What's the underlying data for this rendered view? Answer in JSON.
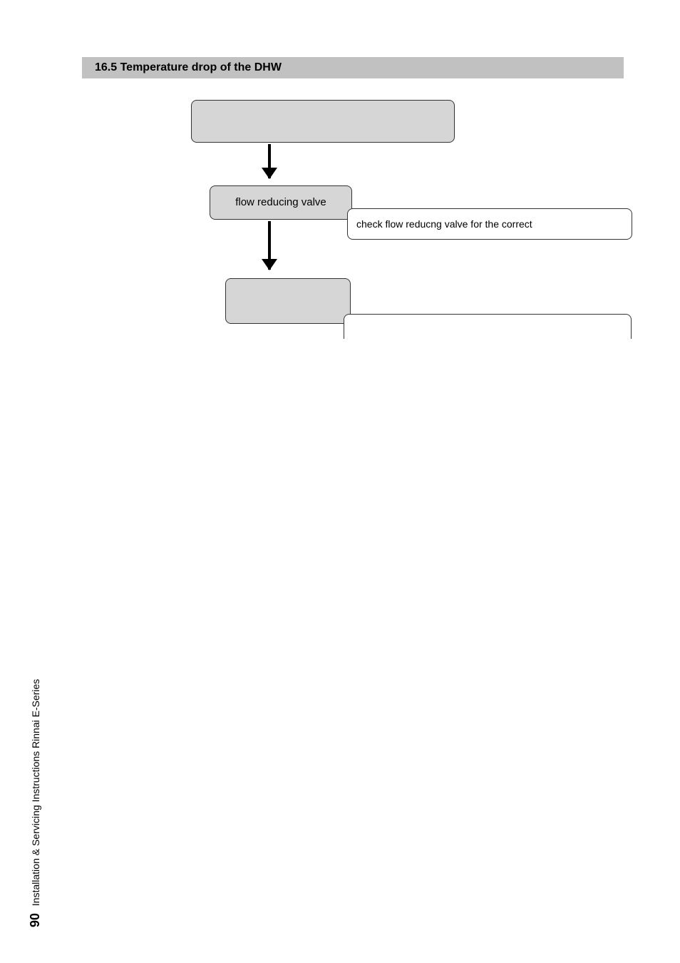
{
  "section": {
    "title": "16.5 Temperature drop of the DHW"
  },
  "flow": {
    "box1": "",
    "box2": "flow reducing valve",
    "box3": "check flow reducng valve for the correct",
    "box4": "",
    "box5": ""
  },
  "footer": {
    "page": "90",
    "doc": "Installation & Servicing Instructions Rinnai E-Series"
  }
}
